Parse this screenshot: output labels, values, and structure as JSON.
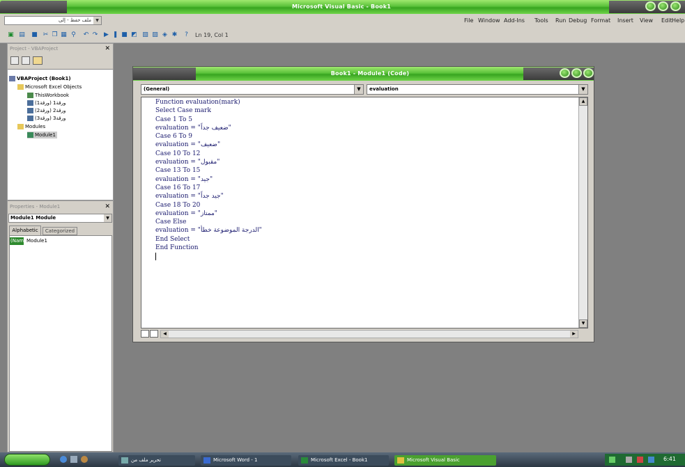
{
  "app": {
    "title": "Microsoft Visual Basic - Book1",
    "address": "ملف حفظ - إلى"
  },
  "menu": [
    "File",
    "Edit",
    "View",
    "Insert",
    "Format",
    "Debug",
    "Run",
    "Tools",
    "Add-Ins",
    "Window",
    "Help"
  ],
  "toolbar": {
    "position": "Ln 19, Col 1"
  },
  "project": {
    "title": "Project - VBAProject",
    "root": "VBAProject (Book1)",
    "excel_objects": "Microsoft Excel Objects",
    "thisworkbook": "ThisWorkbook",
    "sheets": [
      "(ورقة1) ورقة1",
      "(ورقة2) ورقة2",
      "(ورقة3) ورقة3"
    ],
    "modules": "Modules",
    "module1": "Module1"
  },
  "properties": {
    "title": "Properties - Module1",
    "selector": "Module1 Module",
    "tab_alpha": "Alphabetic",
    "tab_cat": "Categorized",
    "prop_name": "(Name)",
    "prop_value": "Module1"
  },
  "codewin": {
    "title": "Book1 - Module1 (Code)",
    "object_combo": "(General)",
    "proc_combo": "evaluation",
    "lines": [
      "Function evaluation(mark)",
      "Select Case mark",
      "Case 1 To 5",
      "evaluation = \"ضعيف جداً\"",
      "Case 6 To 9",
      "evaluation = \"ضعيف\"",
      "Case 10 To 12",
      "evaluation = \"مقبول\"",
      "Case 13 To 15",
      "evaluation = \"جيد\"",
      "Case 16 To 17",
      "evaluation = \"جيد جداً\"",
      "Case 18 To 20",
      "evaluation = \"ممتاز\"",
      "Case Else",
      "evaluation = \"الدرجة الموضوعة خطأ\"",
      "End Select",
      "End Function"
    ]
  },
  "taskbar": {
    "items": [
      "تحرير ملف من",
      "Microsoft Word - 1",
      "Microsoft Excel - Book1",
      "Microsoft Visual Basic"
    ],
    "clock": "6:41"
  }
}
